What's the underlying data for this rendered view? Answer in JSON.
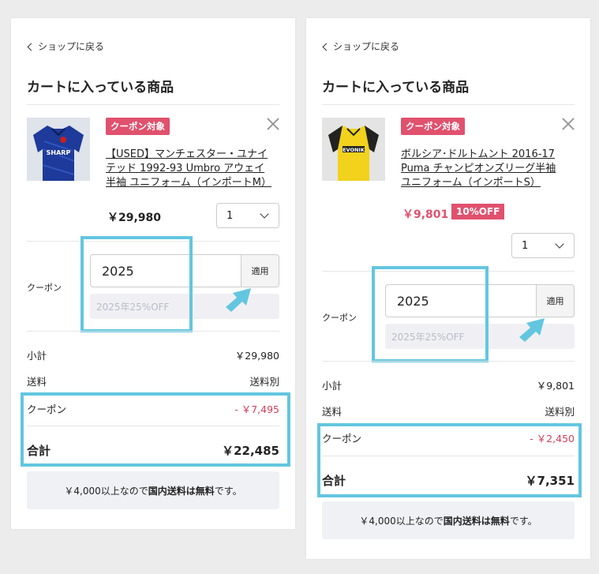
{
  "colors": {
    "accent": "#e0516e",
    "highlight": "#63c6e0",
    "negative": "#d2405a"
  },
  "panels": [
    {
      "back_label": "ショップに戻る",
      "title": "カートに入っている商品",
      "badge": "クーポン対象",
      "product_name": "【USED】マンチェスター・ユナイテッド 1992-93 Umbro アウェイ半袖 ユニフォーム（インポートM）",
      "price": "￥29,980",
      "discount_badge": "",
      "quantity": "1",
      "coupon_label": "クーポン",
      "coupon_code": "2025",
      "apply_label": "適用",
      "coupon_info": "2025年25%OFF",
      "subtotal_label": "小計",
      "subtotal_value": "￥29,980",
      "shipping_label": "送料",
      "shipping_value": "送料別",
      "coupon_row_label": "クーポン",
      "coupon_row_value": "- ￥7,495",
      "total_label": "合計",
      "total_value": "￥22,485",
      "note_prefix": "￥4,000以上なので",
      "note_bold": "国内送料は無料",
      "note_suffix": "です。",
      "shirt_icon": "umbro-sharp-shirt"
    },
    {
      "back_label": "ショップに戻る",
      "title": "カートに入っている商品",
      "badge": "クーポン対象",
      "product_name": "ボルシア･ドルトムント 2016-17 Puma チャンピオンズリーグ半袖 ユニフォーム（インポートS）",
      "price": "￥9,801",
      "discount_badge": "10%OFF",
      "quantity": "1",
      "coupon_label": "クーポン",
      "coupon_code": "2025",
      "apply_label": "適用",
      "coupon_info": "2025年25%OFF",
      "subtotal_label": "小計",
      "subtotal_value": "￥9,801",
      "shipping_label": "送料",
      "shipping_value": "送料別",
      "coupon_row_label": "クーポン",
      "coupon_row_value": "- ￥2,450",
      "total_label": "合計",
      "total_value": "￥7,351",
      "note_prefix": "￥4,000以上なので",
      "note_bold": "国内送料は無料",
      "note_suffix": "です。",
      "shirt_icon": "puma-evonik-shirt"
    }
  ]
}
